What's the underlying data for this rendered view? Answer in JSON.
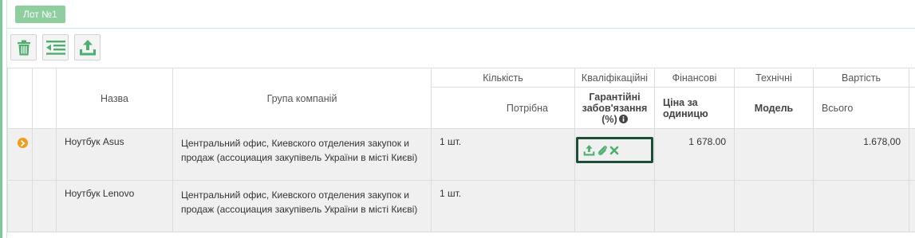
{
  "lot": {
    "tab_label": "Лот №1"
  },
  "toolbar": {
    "buttons": [
      {
        "icon": "trash-icon"
      },
      {
        "icon": "list-outdent-icon"
      },
      {
        "icon": "upload-icon"
      }
    ]
  },
  "table": {
    "group_headers": {
      "name": "Назва",
      "group": "Група компаній",
      "quantity": "Кількість",
      "qualification": "Кваліфікаційні",
      "financial": "Фінансові",
      "technical": "Технічні",
      "cost": "Вартість"
    },
    "sub_headers": {
      "quantity": "Потрібна",
      "guarantee_line1": "Гарантійні",
      "guarantee_line2": "забов'язання",
      "guarantee_line3": "(%)",
      "price_line1": "Ціна за",
      "price_line2": "одиницю",
      "model": "Модель",
      "total": "Всього"
    },
    "rows": [
      {
        "name": "Ноутбук Asus",
        "group": "Центральний офис, Киевского отделения закупок и продаж (ассоциация закупівель України в місті Києві)",
        "quantity": "1 шт.",
        "price": "1 678.00",
        "total": "1.678,00",
        "selected": true
      },
      {
        "name": "Ноутбук Lenovo",
        "group": "Центральний офис, Киевского отделения закупок и продаж (ассоциация закупівель України в місті Києві)",
        "quantity": "1 шт.",
        "price": "",
        "total": "",
        "selected": false
      }
    ]
  },
  "colors": {
    "accent_green": "#8fcf9f",
    "selected_border": "#1d4d36",
    "selected_fill": "#bfdcc8",
    "row_selector_orange": "#f29b1c",
    "icon_green": "#4caf6e"
  }
}
